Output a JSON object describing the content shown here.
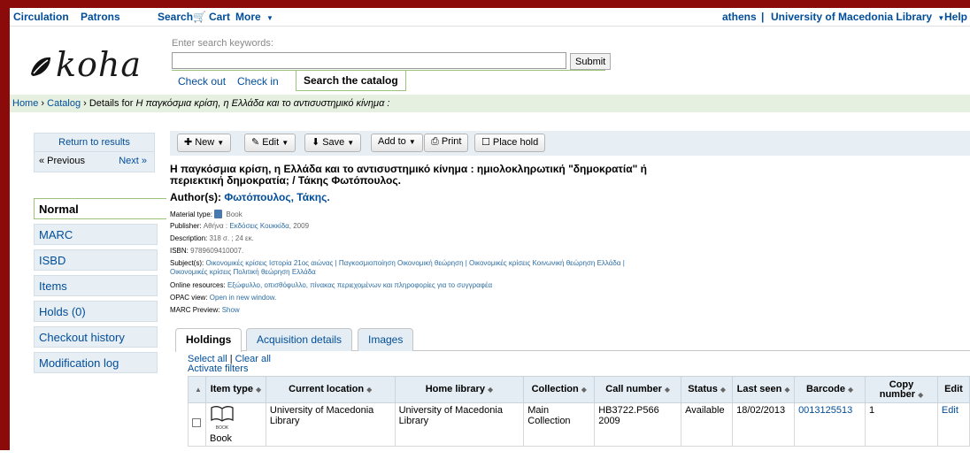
{
  "nav": {
    "circulation": "Circulation",
    "patrons": "Patrons",
    "search": "Search",
    "cart": "Cart",
    "more": "More",
    "user": "athens",
    "separator": "|",
    "library": "University of Macedonia Library",
    "help": "Help"
  },
  "header": {
    "logo": "koha",
    "search_label": "Enter search keywords:",
    "search_value": "",
    "submit": "Submit",
    "tabs": [
      "Check out",
      "Check in",
      "Search the catalog"
    ]
  },
  "breadcrumb": {
    "home": "Home",
    "catalog": "Catalog",
    "details_prefix": "Details for",
    "title": "Η παγκόσμια κρίση, η Ελλάδα και το αντισυστημικό κίνημα :"
  },
  "results": {
    "return": "Return to results",
    "previous": "« Previous",
    "next": "Next »"
  },
  "views": [
    "Normal",
    "MARC",
    "ISBD",
    "Items",
    "Holds (0)",
    "Checkout history",
    "Modification log"
  ],
  "toolbar": {
    "new": "New",
    "edit": "Edit",
    "save": "Save",
    "add_to": "Add to",
    "print": "Print",
    "place_hold": "Place hold"
  },
  "record": {
    "title_line1": "Η παγκόσμια κρίση, η Ελλάδα και το αντισυστημικό κίνημα : ημιολοκληρωτική \"δημοκρατία\" ή",
    "title_line2": "περιεκτική δημοκρατία; / Τάκης Φωτόπουλος.",
    "author_label": "Author(s):",
    "author": "Φωτόπουλος, Τάκης.",
    "material_label": "Material type:",
    "material": "Book",
    "publisher_label": "Publisher:",
    "publisher_place": "Αθήνα :",
    "publisher": "Εκδόσεις Κουκκίδα",
    "publisher_year": ", 2009",
    "description_label": "Description:",
    "description": "318 σ. ; 24 εκ.",
    "isbn_label": "ISBN:",
    "isbn": "9789609410007.",
    "subjects_label": "Subject(s):",
    "subjects_line1": "Οικονομικές κρίσεις Ιστορία 21ος αιώνας | Παγκοσμιοποίηση Οικονομική θεώρηση | Οικονομικές κρίσεις Κοινωνική θεώρηση Ελλάδα |",
    "subjects_line2": "Οικονομικές κρίσεις Πολιτική θεώρηση Ελλάδα",
    "online_label": "Online resources:",
    "online": "Εξώφυλλο, οπισθόφυλλο, πίνακας περιεχομένων και πληροφορίες για το συγγραφέα",
    "opac_label": "OPAC view:",
    "opac": "Open in new window.",
    "marc_label": "MARC Preview:",
    "marc": "Show"
  },
  "tabs": [
    "Holdings",
    "Acquisition details",
    "Images"
  ],
  "holdings": {
    "select_all": "Select all",
    "clear_all": "Clear all",
    "sep": "|",
    "activate_filters": "Activate filters",
    "headers": [
      "Item type",
      "Current location",
      "Home library",
      "Collection",
      "Call number",
      "Status",
      "Last seen",
      "Barcode",
      "Copy number",
      "Edit"
    ],
    "rows": [
      {
        "item_type": "Book",
        "icon_caption": "BOOK",
        "current_location": "University of Macedonia Library",
        "home_library": "University of Macedonia Library",
        "collection": "Main Collection",
        "call_number": "HB3722.P566 2009",
        "status": "Available",
        "last_seen": "18/02/2013",
        "barcode": "0013125513",
        "copy_number": "1",
        "edit": "Edit"
      }
    ]
  }
}
